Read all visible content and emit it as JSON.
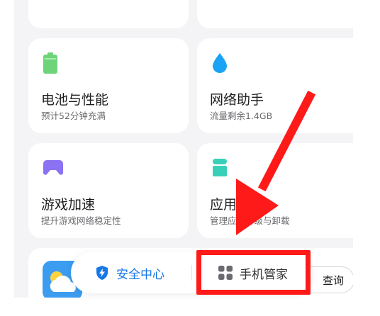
{
  "cards": [
    {
      "title": "电池与性能",
      "subtitle": "预计52分钟充满",
      "icon": "battery-icon",
      "color": "#6ed47a"
    },
    {
      "title": "网络助手",
      "subtitle": "流量剩余1.4GB",
      "icon": "water-drop-icon",
      "color": "#1aa3f5"
    },
    {
      "title": "游戏加速",
      "subtitle": "提升游戏网络稳定性",
      "icon": "gamepad-icon",
      "color": "#8a72f2"
    },
    {
      "title": "应用管理",
      "subtitle": "管理应用升级与卸载",
      "icon": "android-icon",
      "color": "#38d0b8"
    }
  ],
  "bottom_card": {
    "partial_text": "",
    "action_label": "查询",
    "icon": "weather-cloud-icon"
  },
  "bottom_nav": {
    "security_center": {
      "label": "安全中心",
      "icon": "shield-icon"
    },
    "phone_manager": {
      "label": "手机管家",
      "icon": "grid-icon"
    }
  },
  "colors": {
    "accent": "#1677e8",
    "annotation": "#ff1a1a"
  }
}
